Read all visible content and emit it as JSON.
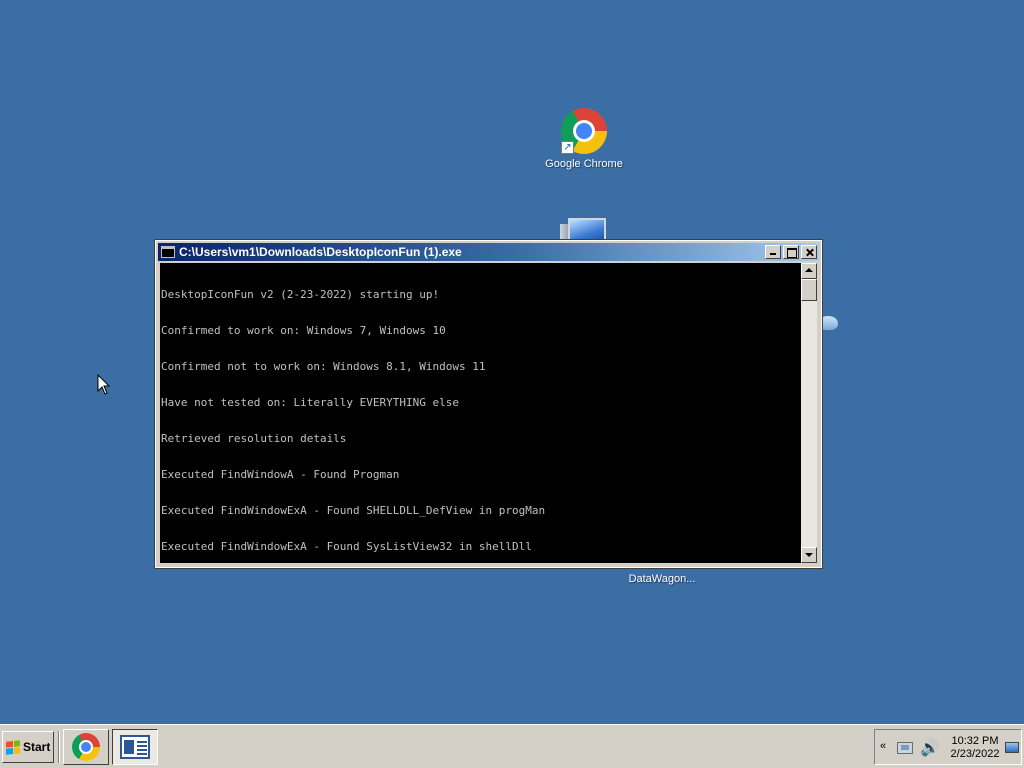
{
  "desktop": {
    "icons": [
      {
        "label": "Google Chrome"
      },
      {
        "label": "DataWagon..."
      }
    ]
  },
  "console": {
    "title": "C:\\Users\\vm1\\Downloads\\DesktopIconFun (1).exe",
    "lines": [
      "DesktopIconFun v2 (2-23-2022) starting up!",
      "Confirmed to work on: Windows 7, Windows 10",
      "Confirmed not to work on: Windows 8.1, Windows 11",
      "Have not tested on: Literally EVERYTHING else",
      "Retrieved resolution details",
      "Executed FindWindowA - Found Progman",
      "Executed FindWindowExA - Found SHELLDLL_DefView in progMan",
      "Executed FindWindowExA - Found SysListView32 in shellDll"
    ]
  },
  "taskbar": {
    "start_label": "Start",
    "clock": {
      "time": "10:32 PM",
      "date": "2/23/2022"
    },
    "tray_chevron": "«"
  },
  "icons": {
    "volume": "🔊"
  }
}
